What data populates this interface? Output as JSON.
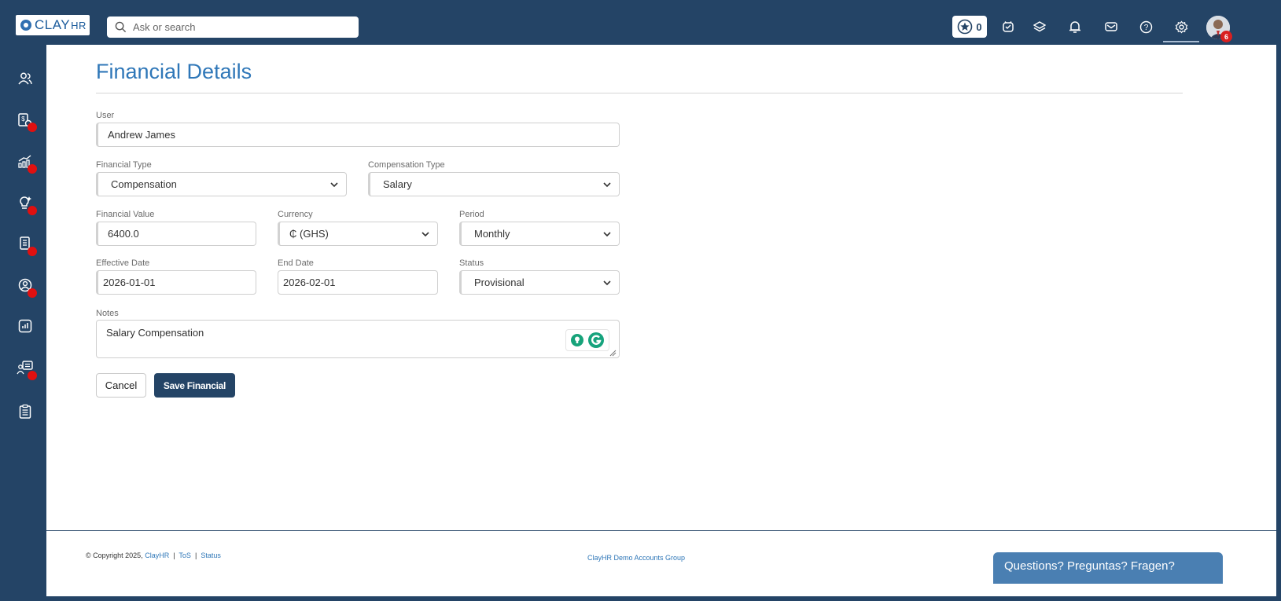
{
  "header": {
    "logo_main": "CLAY",
    "logo_sub": "HR",
    "search_placeholder": "Ask or search",
    "score_value": "0",
    "avatar_badge": "6",
    "icons": [
      "star-icon",
      "clock-icon",
      "layers-icon",
      "bell-icon",
      "mail-icon",
      "help-icon",
      "gear-icon"
    ]
  },
  "sidebar": {
    "items": [
      {
        "name": "people-icon",
        "dot": false
      },
      {
        "name": "payroll-icon",
        "dot": true
      },
      {
        "name": "growth-chart-icon",
        "dot": true
      },
      {
        "name": "ideas-icon",
        "dot": true
      },
      {
        "name": "documents-icon",
        "dot": true
      },
      {
        "name": "user-circle-icon",
        "dot": true
      },
      {
        "name": "reports-icon",
        "dot": false
      },
      {
        "name": "training-icon",
        "dot": true
      },
      {
        "name": "clipboard-icon",
        "dot": false
      }
    ]
  },
  "page": {
    "title": "Financial Details"
  },
  "form": {
    "user_label": "User",
    "user_value": "Andrew James",
    "financial_type_label": "Financial Type",
    "financial_type_value": "Compensation",
    "compensation_type_label": "Compensation Type",
    "compensation_type_value": "Salary",
    "financial_value_label": "Financial Value",
    "financial_value_value": "6400.0",
    "currency_label": "Currency",
    "currency_value": "₵ (GHS)",
    "period_label": "Period",
    "period_value": "Monthly",
    "effective_date_label": "Effective Date",
    "effective_date_value": "2026-01-01",
    "end_date_label": "End Date",
    "end_date_value": "2026-02-01",
    "status_label": "Status",
    "status_value": "Provisional",
    "notes_label": "Notes",
    "notes_value": "Salary Compensation"
  },
  "actions": {
    "cancel_label": "Cancel",
    "save_label": "Save Financial"
  },
  "footer": {
    "copyright": "© Copyright 2025,",
    "company_link": "ClayHR",
    "sep1": "|",
    "tos_link": "ToS",
    "sep2": "|",
    "status_link": "Status",
    "group_name": "ClayHR Demo Accounts Group"
  },
  "chat": {
    "label": "Questions? Preguntas? Fragen?"
  },
  "colors": {
    "nav_bg": "#244466",
    "title_blue": "#2f77b8",
    "alert_red": "#e01010",
    "chat_bg": "#4a7fb2"
  }
}
